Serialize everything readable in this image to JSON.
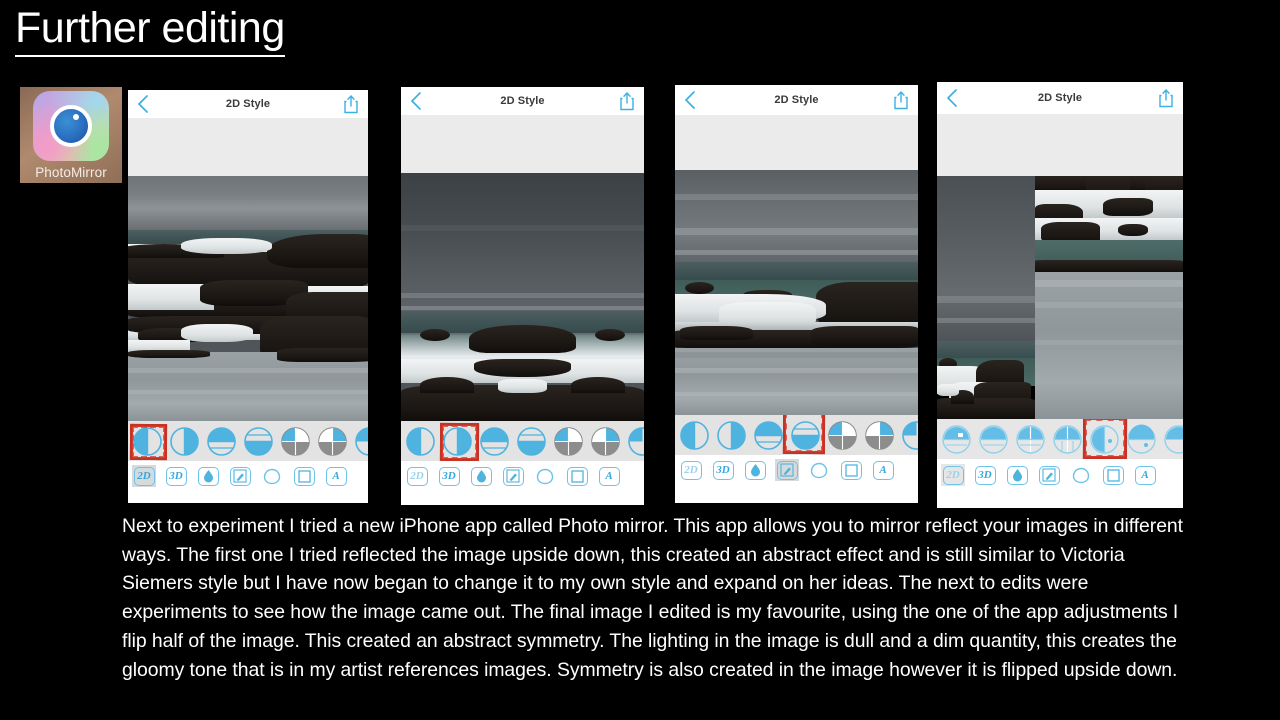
{
  "slide": {
    "title": "Further editing",
    "background_color": "#000000",
    "text_color": "#ffffff"
  },
  "app_icon": {
    "label": "PhotoMirror",
    "icon_name": "photomirror-app-icon",
    "accent_color": "#2a6fc0"
  },
  "phones": [
    {
      "nav": {
        "back_icon": "chevron-left-icon",
        "title": "2D Style",
        "share_icon": "share-upload-icon"
      },
      "photo_description": "Rocky coastline mirrored top-to-bottom, dark rocks with white surf under grey sky",
      "mirror_modes": [
        "split-vertical-left-fill",
        "split-vertical-right-fill",
        "split-horizontal-top-fill",
        "split-horizontal-bottom-fill",
        "quad-diagonal-grey",
        "quad-split-grey",
        "quad-partial"
      ],
      "selected_mirror_index": 0,
      "annotated_mirror_index": 0,
      "tools": [
        "2D",
        "3D",
        "droplet",
        "magic-wand",
        "blob",
        "square",
        "A"
      ],
      "selected_tool": "2D"
    },
    {
      "nav": {
        "back_icon": "chevron-left-icon",
        "title": "2D Style",
        "share_icon": "share-upload-icon"
      },
      "photo_description": "Seascape mirrored left-to-right forming symmetrical dark sky and central rock peak with white surf",
      "mirror_modes": [
        "split-vertical-left-fill",
        "split-vertical-right-fill",
        "split-horizontal-top-fill",
        "split-horizontal-bottom-fill",
        "quad-diagonal-grey",
        "quad-split-grey",
        "quad-partial"
      ],
      "selected_mirror_index": 1,
      "annotated_mirror_index": 1,
      "tools": [
        "2D",
        "3D",
        "droplet",
        "magic-wand",
        "blob",
        "square",
        "A"
      ],
      "selected_tool": "3D"
    },
    {
      "nav": {
        "back_icon": "chevron-left-icon",
        "title": "2D Style",
        "share_icon": "share-upload-icon"
      },
      "photo_description": "Breaking wave over rocks mirrored along a low horizontal axis, reflected sky in water below",
      "mirror_modes": [
        "split-vertical-left-fill",
        "split-vertical-right-fill",
        "split-horizontal-top-fill",
        "split-horizontal-bottom-fill",
        "quad-diagonal-grey",
        "quad-split-grey",
        "quad-partial"
      ],
      "selected_mirror_index": 3,
      "annotated_mirror_index": 3,
      "tools": [
        "2D",
        "3D",
        "droplet",
        "magic-wand",
        "blob",
        "square",
        "A"
      ],
      "selected_tool": "magic-wand"
    },
    {
      "nav": {
        "back_icon": "chevron-left-icon",
        "title": "2D Style",
        "share_icon": "share-upload-icon"
      },
      "photo_description": "Image split vertically, left half upright seascape and right half flipped upside down creating abstract symmetry",
      "mirror_modes": [
        "half-top-fill",
        "half-bottom-fill",
        "quad-split",
        "quad-split-lines",
        "circle-split-dot",
        "circle-half-dot",
        "circle-extra"
      ],
      "selected_mirror_index": 4,
      "annotated_mirror_index": 4,
      "tools": [
        "2D",
        "3D",
        "droplet",
        "magic-wand",
        "blob",
        "square",
        "A"
      ],
      "selected_tool": "3D"
    }
  ],
  "body": {
    "paragraph": "Next to experiment I tried a new iPhone app called Photo mirror. This app allows you to mirror reflect your images in different ways. The first one I tried reflected the image upside down, this created an abstract effect and is still similar to Victoria Siemers style but I have now began to change it to my own style and expand on her ideas. The next to edits were experiments to see how the image came out. The final image I edited is my favourite, using the one of the app adjustments I flip half of the image. This created an abstract symmetry. The lighting in the image is dull and a dim quantity, this creates the gloomy tone that is in my artist references images. Symmetry is also created in the image however it is flipped upside down."
  },
  "annotation": {
    "color": "#d93a2b",
    "style": "hand-drawn rectangle highlight"
  }
}
